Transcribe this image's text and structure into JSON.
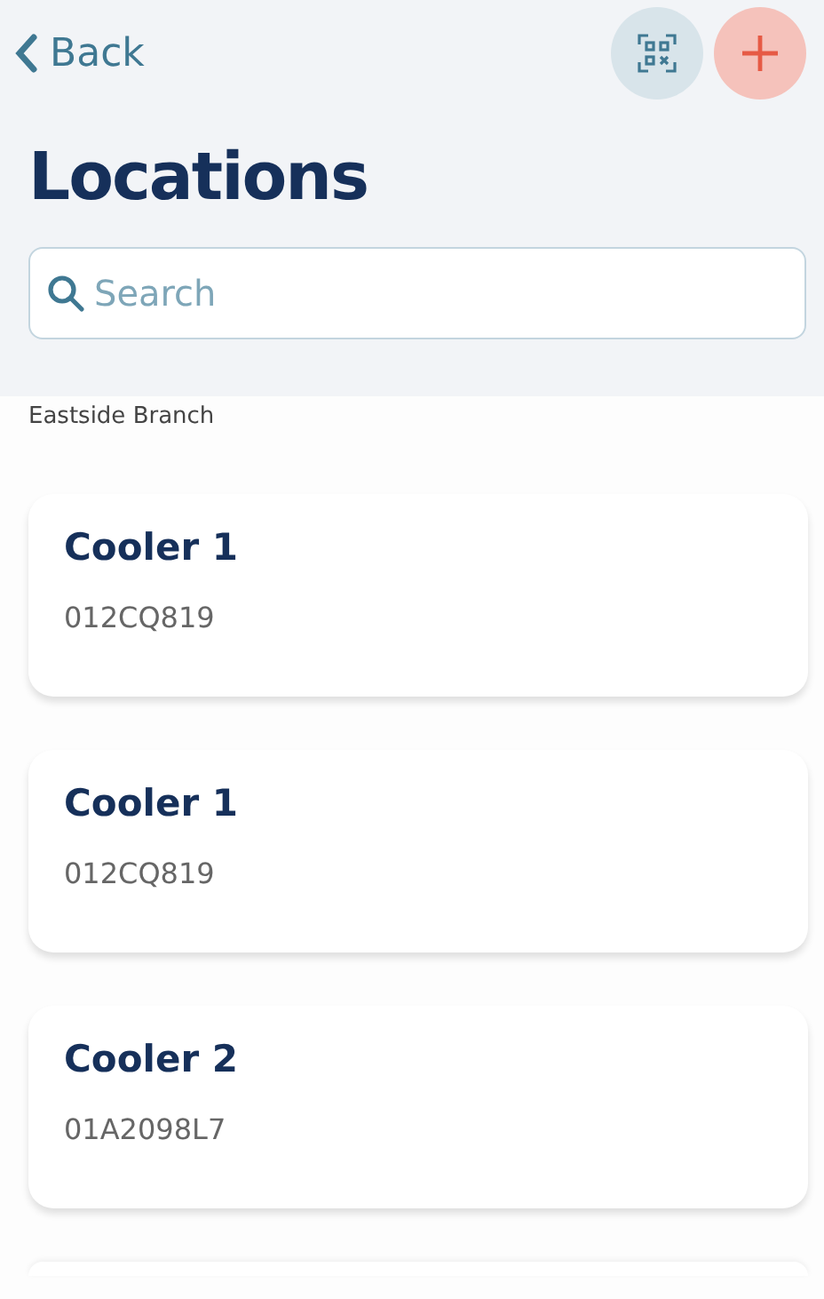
{
  "nav": {
    "back_label": "Back"
  },
  "title": "Locations",
  "search": {
    "placeholder": "Search"
  },
  "group_label": "Eastside Branch",
  "locations": [
    {
      "name": "Cooler 1",
      "code": "012CQ819"
    },
    {
      "name": "Cooler 1",
      "code": "012CQ819"
    },
    {
      "name": "Cooler 2",
      "code": "01A2098L7"
    }
  ]
}
